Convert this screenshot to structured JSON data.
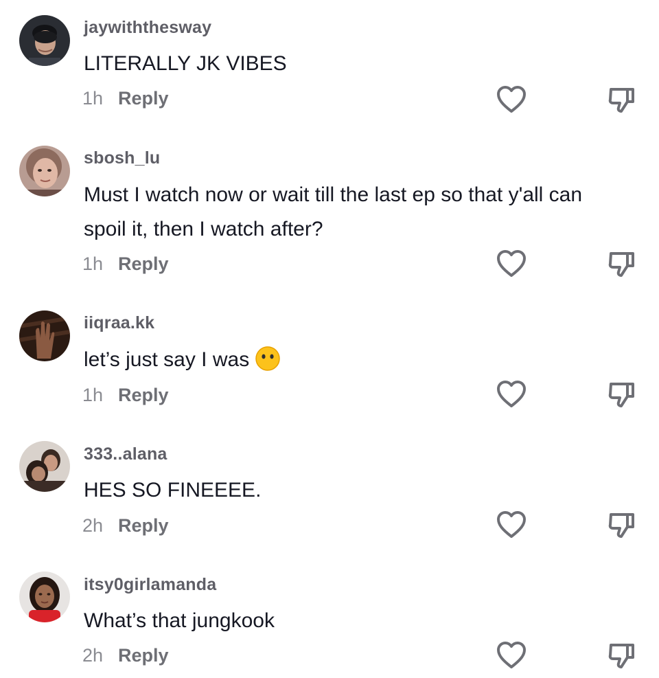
{
  "comments": [
    {
      "username": "jaywiththesway",
      "text": "LITERALLY JK VIBES",
      "time": "1h",
      "reply_label": "Reply",
      "avatar_icon": "avatar-person-icon"
    },
    {
      "username": "sbosh_lu",
      "text": "Must I watch now or wait till the last ep so that y'all can spoil it, then I watch after?",
      "time": "1h",
      "reply_label": "Reply",
      "avatar_icon": "avatar-person-icon"
    },
    {
      "username": "iiqraa.kk",
      "text": "let’s just say I was",
      "emoji": "face-without-mouth-emoji",
      "time": "1h",
      "reply_label": "Reply",
      "avatar_icon": "avatar-hand-icon"
    },
    {
      "username": "333..alana",
      "text": "HES SO FINEEEE.",
      "time": "2h",
      "reply_label": "Reply",
      "avatar_icon": "avatar-couple-icon"
    },
    {
      "username": "itsy0girlamanda",
      "text": "What’s that jungkook",
      "time": "2h",
      "reply_label": "Reply",
      "avatar_icon": "avatar-person-icon"
    }
  ],
  "icons": {
    "like": "heart-outline-icon",
    "dislike": "thumbs-down-outline-icon"
  },
  "colors": {
    "text": "#161823",
    "username": "#5e5e66",
    "meta": "#8a8b91",
    "icon_stroke": "#6e6f75"
  }
}
